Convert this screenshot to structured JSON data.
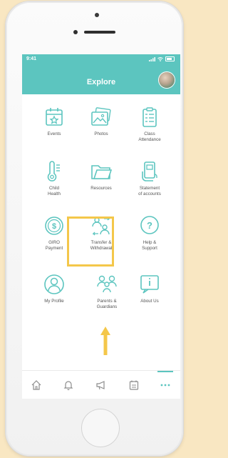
{
  "status_bar": {
    "time": "9:41"
  },
  "header": {
    "title": "Explore"
  },
  "tiles": [
    {
      "label": "Events",
      "icon": "calendar-star-icon"
    },
    {
      "label": "Photos",
      "icon": "photos-icon"
    },
    {
      "label": "Class\nAttendance",
      "icon": "checklist-icon"
    },
    {
      "label": "Child\nHealth",
      "icon": "thermometer-icon"
    },
    {
      "label": "Resources",
      "icon": "folder-icon"
    },
    {
      "label": "Statement\nof accounts",
      "icon": "card-in-hand-icon"
    },
    {
      "label": "GIRO\nPayment",
      "icon": "dollar-coin-icon"
    },
    {
      "label": "Transfer &\nWithdrawal",
      "icon": "transfer-users-icon"
    },
    {
      "label": "Help &\nSupport",
      "icon": "question-bubble-icon"
    },
    {
      "label": "My Profile",
      "icon": "user-circle-icon"
    },
    {
      "label": "Parents &\nGuardians",
      "icon": "family-icon"
    },
    {
      "label": "About Us",
      "icon": "info-bubble-icon"
    }
  ],
  "tabbar": [
    {
      "icon": "home-icon"
    },
    {
      "icon": "bell-icon"
    },
    {
      "icon": "megaphone-icon"
    },
    {
      "icon": "calendar-list-icon"
    },
    {
      "icon": "more-dots-icon",
      "active": true
    }
  ],
  "colors": {
    "accent": "#5cc5bf",
    "highlight": "#f4c74a",
    "background": "#f9e7c2"
  }
}
